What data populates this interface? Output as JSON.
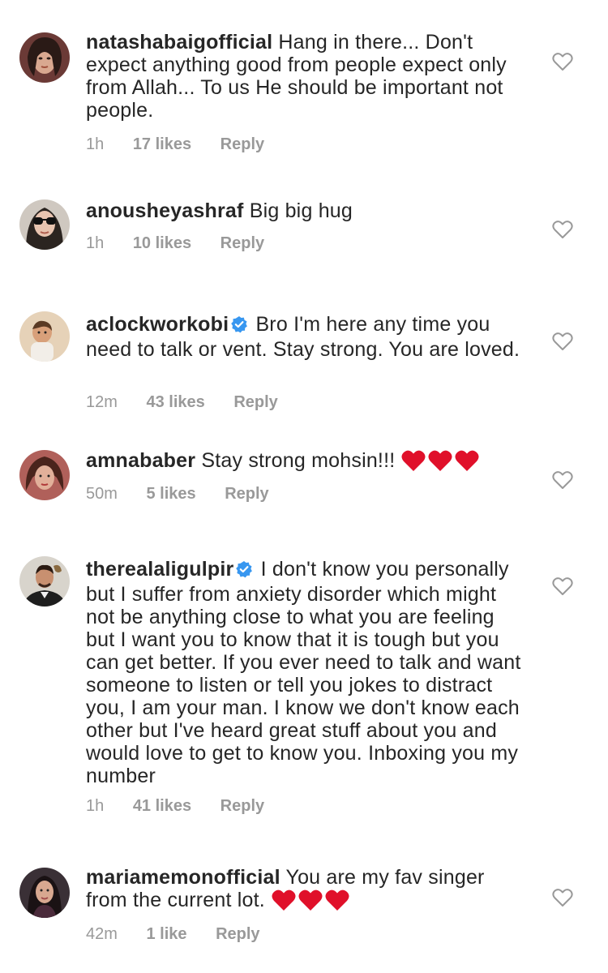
{
  "comments": [
    {
      "username": "natashabaigofficial",
      "text": "Hang in there... Don't expect anything good from people expect only from Allah... To us He should be important not people.",
      "time": "1h",
      "likes": "17 likes",
      "reply": "Reply",
      "verified": false,
      "emoji": "",
      "avatar_color": "#7a4a4a"
    },
    {
      "username": "anousheyashraf",
      "text": "Big big hug",
      "time": "1h",
      "likes": "10 likes",
      "reply": "Reply",
      "verified": false,
      "emoji": "",
      "avatar_color": "#3d3a36"
    },
    {
      "username": "aclockworkobi",
      "text": "Bro I'm here any time you need to talk or vent. Stay strong. You are loved.",
      "time": "12m",
      "likes": "43 likes",
      "reply": "Reply",
      "verified": true,
      "emoji": "",
      "avatar_color": "#c89b78"
    },
    {
      "username": "amnababer",
      "text": "Stay strong mohsin!!!",
      "time": "50m",
      "likes": "5 likes",
      "reply": "Reply",
      "verified": false,
      "emoji": "❤️❤️❤️",
      "avatar_color": "#8c4a40"
    },
    {
      "username": "therealaligulpir",
      "text": "I don't know you personally but I suffer from anxiety disorder which might not be anything close to what you are feeling but I want you to know that it is tough but you can get better. If you ever need to talk and want someone to listen or tell you jokes to distract you, I am your man. I know we don't know each other but I've heard great stuff about you and would love to get to know you. Inboxing you my number",
      "time": "1h",
      "likes": "41 likes",
      "reply": "Reply",
      "verified": true,
      "emoji": "",
      "avatar_color": "#5a5a5a"
    },
    {
      "username": "mariamemonofficial",
      "text": "You are my fav singer from the current lot.",
      "time": "42m",
      "likes": "1 like",
      "reply": "Reply",
      "verified": false,
      "emoji": "❤️❤️❤️",
      "avatar_color": "#3a2a2a"
    }
  ],
  "colors": {
    "verified_badge": "#3897f0",
    "heart_emoji": "#e0102a",
    "meta_text": "#999999",
    "like_outline": "#999999"
  }
}
